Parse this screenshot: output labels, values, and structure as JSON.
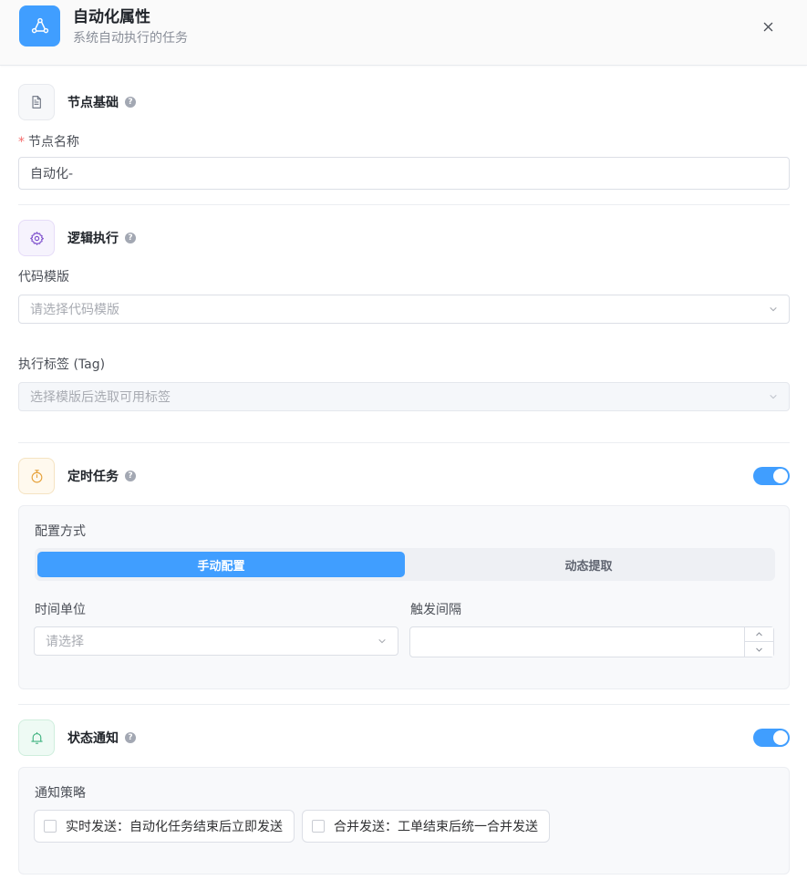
{
  "header": {
    "title": "自动化属性",
    "subtitle": "系统自动执行的任务"
  },
  "basic": {
    "title": "节点基础",
    "name_label": "节点名称",
    "required_mark": "*",
    "name_value": "自动化-"
  },
  "logic": {
    "title": "逻辑执行",
    "template_label": "代码模版",
    "template_placeholder": "请选择代码模版",
    "tag_label": "执行标签 (Tag)",
    "tag_placeholder": "选择模版后选取可用标签"
  },
  "timer": {
    "title": "定时任务",
    "enabled": true,
    "config_label": "配置方式",
    "tabs": [
      "手动配置",
      "动态提取"
    ],
    "active_tab": "手动配置",
    "unit_label": "时间单位",
    "unit_placeholder": "请选择",
    "interval_label": "触发间隔",
    "interval_value": ""
  },
  "notify": {
    "title": "状态通知",
    "enabled": true,
    "strategy_label": "通知策略",
    "options": [
      {
        "label": "实时发送：自动化任务结束后立即发送",
        "checked": false
      },
      {
        "label": "合并发送：工单结束后统一合并发送",
        "checked": false
      }
    ]
  },
  "colors": {
    "primary": "#409eff",
    "required": "#f56c6c"
  },
  "icons": {
    "header": "workflow-icon",
    "close": "close-icon",
    "basic": "document-icon",
    "logic": "gear-icon",
    "timer": "stopwatch-icon",
    "notify": "bell-icon",
    "help": "question-icon",
    "dropdown": "chevron-down-icon"
  }
}
